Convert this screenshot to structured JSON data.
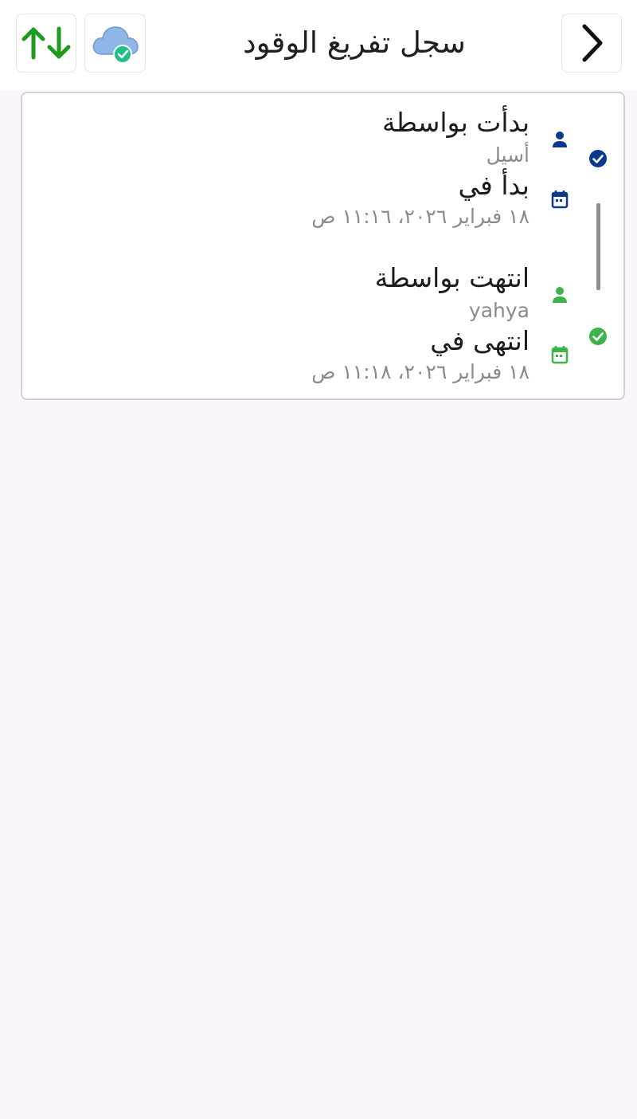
{
  "header": {
    "title": "سجل تفريغ الوقود",
    "back_icon": "chevron-right-icon",
    "cloud_icon": "cloud-synced-icon",
    "sort_icon": "sort-arrows-icon"
  },
  "log": {
    "started": {
      "by_label": "بدأت بواسطة",
      "by_value": "أسيل",
      "at_label": "بدأ في",
      "at_value": "١٨ فبراير ٢٠٢٦، ١١:١٦ ص",
      "status_icon": "check-circle-icon",
      "color": "#0b3a8c"
    },
    "ended": {
      "by_label": "انتهت بواسطة",
      "by_value": "yahya",
      "at_label": "انتهى في",
      "at_value": "١٨ فبراير ٢٠٢٦، ١١:١٨ ص",
      "status_icon": "check-circle-icon",
      "color": "#3db34a"
    }
  },
  "colors": {
    "background": "#fbf5fd",
    "accent_green": "#1e9a1e",
    "accent_blue": "#0b3a8c"
  }
}
